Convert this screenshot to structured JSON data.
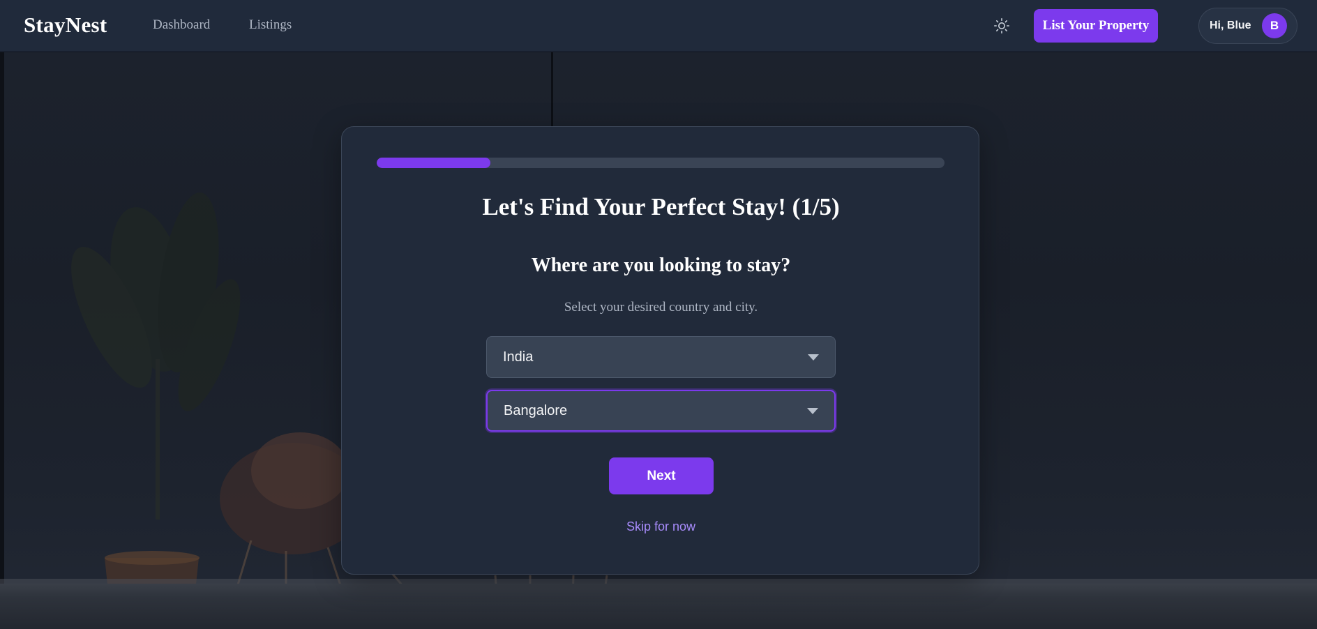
{
  "header": {
    "logo": "StayNest",
    "nav": [
      {
        "label": "Dashboard"
      },
      {
        "label": "Listings"
      }
    ],
    "theme_icon": "sun-icon",
    "list_property_label": "List Your Property",
    "user": {
      "greeting": "Hi, Blue",
      "avatar_initial": "B"
    }
  },
  "onboarding": {
    "progress_fraction": 0.2,
    "title": "Let's Find Your Perfect Stay! (1/5)",
    "question": "Where are you looking to stay?",
    "hint": "Select your desired country and city.",
    "country_select": {
      "value": "India"
    },
    "city_select": {
      "value": "Bangalore"
    },
    "next_label": "Next",
    "skip_label": "Skip for now"
  },
  "colors": {
    "accent": "#7c3aed",
    "link": "#a78bfa",
    "header_bg": "#202a3b",
    "card_bg": "#212a3a"
  }
}
